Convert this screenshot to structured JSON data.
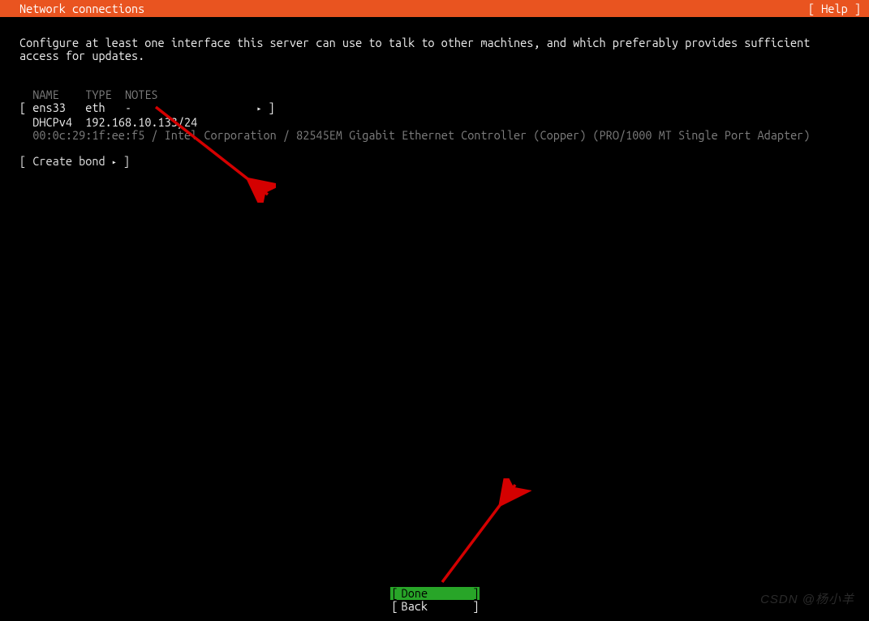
{
  "titlebar": {
    "title": "Network connections",
    "help": "[ Help ]"
  },
  "instruction": "Configure at least one interface this server can use to talk to other machines, and which preferably provides sufficient access for updates.",
  "table": {
    "columns": {
      "name": "NAME",
      "type": "TYPE",
      "notes": "NOTES"
    },
    "interface": {
      "name": "ens33",
      "type": "eth",
      "notes": "-",
      "dhcp_label": "DHCPv4",
      "address": "192.168.10.133/24",
      "mac": "00:0c:29:1f:ee:f5",
      "hw_desc": "Intel Corporation / 82545EM Gigabit Ethernet Controller (Copper) (PRO/1000 MT Single Port Adapter)"
    }
  },
  "bond": {
    "label": "Create bond"
  },
  "buttons": {
    "done": "Done",
    "back": "Back"
  },
  "brackets": {
    "l": "[",
    "r": "]"
  },
  "glyphs": {
    "triangle": "▸",
    "slash": "/"
  },
  "watermark": "CSDN @杨小羊"
}
